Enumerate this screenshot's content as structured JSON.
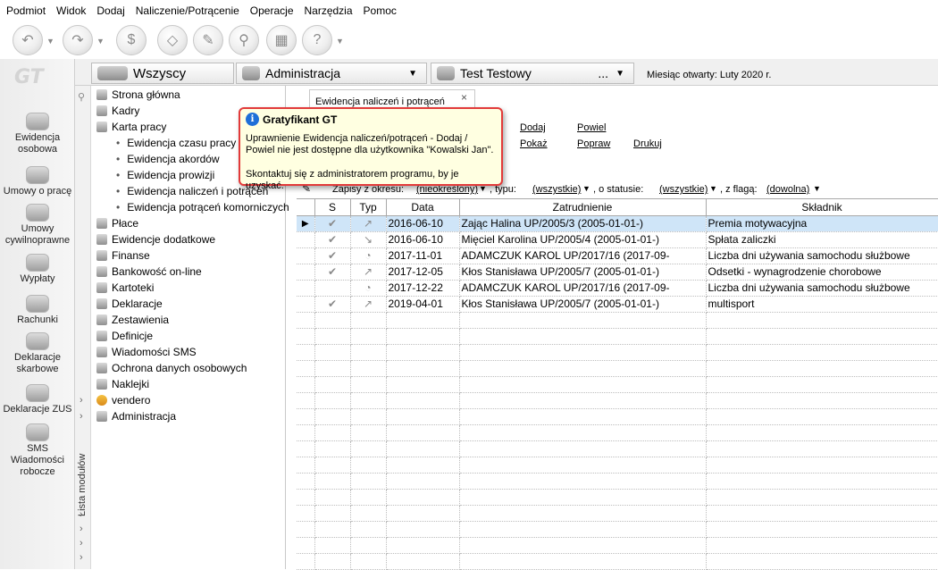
{
  "menu": [
    "Podmiot",
    "Widok",
    "Dodaj",
    "Naliczenie/Potrącenie",
    "Operacje",
    "Narzędzia",
    "Pomoc"
  ],
  "logo": "GT",
  "left_nav": [
    {
      "label": "Ewidencja osobowa",
      "icon": "people-icon"
    },
    {
      "label": "Umowy o pracę",
      "icon": "contract-icon"
    },
    {
      "label": "Umowy cywilnoprawne",
      "icon": "civil-contract-icon"
    },
    {
      "label": "Wypłaty",
      "icon": "payout-icon"
    },
    {
      "label": "Rachunki",
      "icon": "bill-icon"
    },
    {
      "label": "Deklaracje skarbowe",
      "icon": "tax-declaration-icon"
    },
    {
      "label": "Deklaracje ZUS",
      "icon": "zus-icon"
    },
    {
      "label": "SMS Wiadomości robocze",
      "icon": "sms-icon"
    }
  ],
  "top_tabs": {
    "all": "Wszyscy",
    "admin": "Administracja",
    "user": "Test Testowy",
    "user_ellipsis": "...",
    "month_label": "Miesiąc otwarty: Luty 2020 r."
  },
  "modules": {
    "strip_label": "Lista modułów",
    "items": [
      "Strona główna",
      "Kadry",
      "Karta pracy"
    ],
    "sub_items": [
      "Ewidencja czasu pracy",
      "Ewidencja akordów",
      "Ewidencja prowizji",
      "Ewidencja naliczeń i potrąceń",
      "Ewidencja potrąceń komorniczych"
    ],
    "items2": [
      "Płace",
      "Ewidencje dodatkowe",
      "Finanse",
      "Bankowość on-line",
      "Kartoteki",
      "Deklaracje",
      "Zestawienia",
      "Definicje",
      "Wiadomości SMS",
      "Ochrona danych osobowych",
      "Naklejki",
      "vendero",
      "Administracja"
    ]
  },
  "doc_tab": {
    "label": "Ewidencja naliczeń i potrąceń",
    "close": "×"
  },
  "actions": {
    "dodaj": "Dodaj",
    "powiel": "Powiel",
    "pokaz": "Pokaż",
    "popraw": "Popraw",
    "drukuj": "Drukuj"
  },
  "filter": {
    "period_label": "Zapisy z okresu:",
    "period_value": "(nieokreślony)",
    "type_label": ", typu:",
    "type_value": "(wszystkie)",
    "status_label": ", o statusie:",
    "status_value": "(wszystkie)",
    "flag_label": ", z flagą:",
    "flag_value": "(dowolna)"
  },
  "table": {
    "headers": {
      "s": "S",
      "typ": "Typ",
      "data": "Data",
      "zatrudnienie": "Zatrudnienie",
      "skladnik": "Składnik"
    },
    "rows": [
      {
        "date": "2016-06-10",
        "employee": "Zając Halina UP/2005/3 (2005-01-01-)",
        "component": "Premia motywacyjna",
        "checked": true,
        "type_icon": "↗",
        "selected": true
      },
      {
        "date": "2016-06-10",
        "employee": "Mięciel Karolina UP/2005/4 (2005-01-01-)",
        "component": "Spłata zaliczki",
        "checked": true,
        "type_icon": "↘",
        "selected": false
      },
      {
        "date": "2017-11-01",
        "employee": "ADAMCZUK KAROL UP/2017/16 (2017-09-",
        "component": "Liczba dni używania samochodu służbowe",
        "checked": true,
        "type_icon": "◔",
        "selected": false
      },
      {
        "date": "2017-12-05",
        "employee": "Kłos Stanisława UP/2005/7 (2005-01-01-)",
        "component": "Odsetki - wynagrodzenie chorobowe",
        "checked": true,
        "type_icon": "↗",
        "selected": false
      },
      {
        "date": "2017-12-22",
        "employee": "ADAMCZUK KAROL UP/2017/16 (2017-09-",
        "component": "Liczba dni używania samochodu służbowe",
        "checked": false,
        "type_icon": "◔",
        "selected": false
      },
      {
        "date": "2019-04-01",
        "employee": "Kłos Stanisława UP/2005/7 (2005-01-01-)",
        "component": "multisport",
        "checked": true,
        "type_icon": "↗",
        "selected": false
      }
    ]
  },
  "tooltip": {
    "title": "Gratyfikant GT",
    "line1": "Uprawnienie Ewidencja naliczeń/potrąceń - Dodaj / Powiel nie jest dostępne dla użytkownika \"Kowalski Jan\".",
    "line2": "Skontaktuj się z administratorem programu, by je uzyskać."
  }
}
